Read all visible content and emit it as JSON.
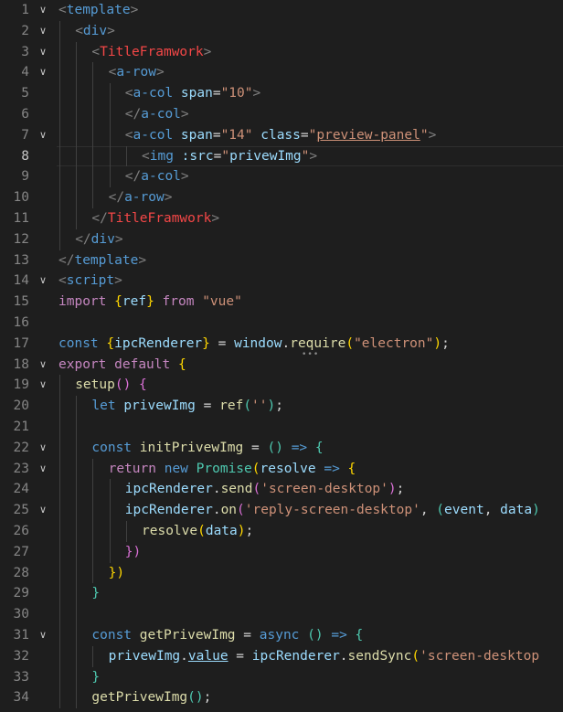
{
  "editor": {
    "current_line": 8,
    "lines": [
      {
        "n": "1",
        "fold": "v",
        "indent": 0,
        "tokens": [
          [
            "t-punc",
            "<"
          ],
          [
            "t-tag",
            "template"
          ],
          [
            "t-punc",
            ">"
          ]
        ]
      },
      {
        "n": "2",
        "fold": "v",
        "indent": 1,
        "tokens": [
          [
            "t-punc",
            "<"
          ],
          [
            "t-tag",
            "div"
          ],
          [
            "t-punc",
            ">"
          ]
        ]
      },
      {
        "n": "3",
        "fold": "v",
        "indent": 2,
        "tokens": [
          [
            "t-punc",
            "<"
          ],
          [
            "t-comp",
            "TitleFramwork"
          ],
          [
            "t-punc",
            ">"
          ]
        ]
      },
      {
        "n": "4",
        "fold": "v",
        "indent": 3,
        "tokens": [
          [
            "t-punc",
            "<"
          ],
          [
            "t-tag",
            "a-row"
          ],
          [
            "t-punc",
            ">"
          ]
        ]
      },
      {
        "n": "5",
        "fold": "",
        "indent": 4,
        "tokens": [
          [
            "t-punc",
            "<"
          ],
          [
            "t-tag",
            "a-col"
          ],
          [
            "t-op",
            " "
          ],
          [
            "t-attr",
            "span"
          ],
          [
            "t-op",
            "="
          ],
          [
            "t-str",
            "\"10\""
          ],
          [
            "t-punc",
            ">"
          ]
        ]
      },
      {
        "n": "6",
        "fold": "",
        "indent": 4,
        "tokens": [
          [
            "t-punc",
            "</"
          ],
          [
            "t-tag",
            "a-col"
          ],
          [
            "t-punc",
            ">"
          ]
        ]
      },
      {
        "n": "7",
        "fold": "v",
        "indent": 4,
        "tokens": [
          [
            "t-punc",
            "<"
          ],
          [
            "t-tag",
            "a-col"
          ],
          [
            "t-op",
            " "
          ],
          [
            "t-attr",
            "span"
          ],
          [
            "t-op",
            "="
          ],
          [
            "t-str",
            "\"14\""
          ],
          [
            "t-op",
            " "
          ],
          [
            "t-attr",
            "class"
          ],
          [
            "t-op",
            "="
          ],
          [
            "t-str",
            "\""
          ],
          [
            "t-str-u",
            "preview-panel"
          ],
          [
            "t-str",
            "\""
          ],
          [
            "t-punc",
            ">"
          ]
        ]
      },
      {
        "n": "8",
        "fold": "",
        "indent": 5,
        "tokens": [
          [
            "t-punc",
            "<"
          ],
          [
            "t-tag",
            "img"
          ],
          [
            "t-op",
            " "
          ],
          [
            "t-attr",
            ":src"
          ],
          [
            "t-op",
            "="
          ],
          [
            "t-str",
            "\""
          ],
          [
            "t-var",
            "privewImg"
          ],
          [
            "t-str",
            "\""
          ],
          [
            "t-punc",
            ">"
          ]
        ]
      },
      {
        "n": "9",
        "fold": "",
        "indent": 4,
        "tokens": [
          [
            "t-punc",
            "</"
          ],
          [
            "t-tag",
            "a-col"
          ],
          [
            "t-punc",
            ">"
          ]
        ]
      },
      {
        "n": "10",
        "fold": "",
        "indent": 3,
        "tokens": [
          [
            "t-punc",
            "</"
          ],
          [
            "t-tag",
            "a-row"
          ],
          [
            "t-punc",
            ">"
          ]
        ]
      },
      {
        "n": "11",
        "fold": "",
        "indent": 2,
        "tokens": [
          [
            "t-punc",
            "</"
          ],
          [
            "t-comp",
            "TitleFramwork"
          ],
          [
            "t-punc",
            ">"
          ]
        ]
      },
      {
        "n": "12",
        "fold": "",
        "indent": 1,
        "tokens": [
          [
            "t-punc",
            "</"
          ],
          [
            "t-tag",
            "div"
          ],
          [
            "t-punc",
            ">"
          ]
        ]
      },
      {
        "n": "13",
        "fold": "",
        "indent": 0,
        "tokens": [
          [
            "t-punc",
            "</"
          ],
          [
            "t-tag",
            "template"
          ],
          [
            "t-punc",
            ">"
          ]
        ]
      },
      {
        "n": "14",
        "fold": "v",
        "indent": 0,
        "tokens": [
          [
            "t-punc",
            "<"
          ],
          [
            "t-tag",
            "script"
          ],
          [
            "t-punc",
            ">"
          ]
        ]
      },
      {
        "n": "15",
        "fold": "",
        "indent": 0,
        "tokens": [
          [
            "t-kw",
            "import"
          ],
          [
            "t-op",
            " "
          ],
          [
            "t-brace",
            "{"
          ],
          [
            "t-var",
            "ref"
          ],
          [
            "t-brace",
            "}"
          ],
          [
            "t-op",
            " "
          ],
          [
            "t-kw",
            "from"
          ],
          [
            "t-op",
            " "
          ],
          [
            "t-str",
            "\"vue\""
          ]
        ]
      },
      {
        "n": "16",
        "fold": "",
        "indent": 0,
        "tokens": []
      },
      {
        "n": "17",
        "fold": "",
        "indent": 0,
        "tokens": [
          [
            "t-decl",
            "const"
          ],
          [
            "t-op",
            " "
          ],
          [
            "t-brace",
            "{"
          ],
          [
            "t-var",
            "ipcRenderer"
          ],
          [
            "t-brace",
            "}"
          ],
          [
            "t-op",
            " = "
          ],
          [
            "t-var",
            "window"
          ],
          [
            "t-op",
            "."
          ],
          [
            "t-fn",
            "require"
          ],
          [
            "t-brace",
            "("
          ],
          [
            "t-str",
            "\"electron\""
          ],
          [
            "t-brace",
            ")"
          ],
          [
            "t-op",
            ";"
          ]
        ]
      },
      {
        "n": "18",
        "fold": "v",
        "indent": 0,
        "tokens": [
          [
            "t-kw",
            "export"
          ],
          [
            "t-op",
            " "
          ],
          [
            "t-kw",
            "default"
          ],
          [
            "t-op",
            " "
          ],
          [
            "t-brace",
            "{"
          ]
        ]
      },
      {
        "n": "19",
        "fold": "v",
        "indent": 1,
        "tokens": [
          [
            "t-fn",
            "setup"
          ],
          [
            "t-brace2",
            "()"
          ],
          [
            "t-op",
            " "
          ],
          [
            "t-brace2",
            "{"
          ]
        ]
      },
      {
        "n": "20",
        "fold": "",
        "indent": 2,
        "tokens": [
          [
            "t-decl",
            "let"
          ],
          [
            "t-op",
            " "
          ],
          [
            "t-var",
            "privewImg"
          ],
          [
            "t-op",
            " = "
          ],
          [
            "t-fn",
            "ref"
          ],
          [
            "t-cls",
            "("
          ],
          [
            "t-str",
            "''"
          ],
          [
            "t-cls",
            ")"
          ],
          [
            "t-op",
            ";"
          ]
        ]
      },
      {
        "n": "21",
        "fold": "",
        "indent": 2,
        "tokens": []
      },
      {
        "n": "22",
        "fold": "v",
        "indent": 2,
        "tokens": [
          [
            "t-decl",
            "const"
          ],
          [
            "t-op",
            " "
          ],
          [
            "t-fn",
            "initPrivewImg"
          ],
          [
            "t-op",
            " = "
          ],
          [
            "t-cls",
            "()"
          ],
          [
            "t-op",
            " "
          ],
          [
            "t-decl",
            "=>"
          ],
          [
            "t-op",
            " "
          ],
          [
            "t-cls",
            "{"
          ]
        ]
      },
      {
        "n": "23",
        "fold": "v",
        "indent": 3,
        "tokens": [
          [
            "t-kw",
            "return"
          ],
          [
            "t-op",
            " "
          ],
          [
            "t-decl",
            "new"
          ],
          [
            "t-op",
            " "
          ],
          [
            "t-cls",
            "Promise"
          ],
          [
            "t-brace",
            "("
          ],
          [
            "t-var",
            "resolve"
          ],
          [
            "t-op",
            " "
          ],
          [
            "t-decl",
            "=>"
          ],
          [
            "t-op",
            " "
          ],
          [
            "t-brace",
            "{"
          ]
        ]
      },
      {
        "n": "24",
        "fold": "",
        "indent": 4,
        "tokens": [
          [
            "t-var",
            "ipcRenderer"
          ],
          [
            "t-op",
            "."
          ],
          [
            "t-fn",
            "send"
          ],
          [
            "t-brace2",
            "("
          ],
          [
            "t-str",
            "'screen-desktop'"
          ],
          [
            "t-brace2",
            ")"
          ],
          [
            "t-op",
            ";"
          ]
        ]
      },
      {
        "n": "25",
        "fold": "v",
        "indent": 4,
        "tokens": [
          [
            "t-var",
            "ipcRenderer"
          ],
          [
            "t-op",
            "."
          ],
          [
            "t-fn",
            "on"
          ],
          [
            "t-brace2",
            "("
          ],
          [
            "t-str",
            "'reply-screen-desktop'"
          ],
          [
            "t-op",
            ", "
          ],
          [
            "t-cls",
            "("
          ],
          [
            "t-var",
            "event"
          ],
          [
            "t-op",
            ", "
          ],
          [
            "t-var",
            "data"
          ],
          [
            "t-cls",
            ")"
          ]
        ]
      },
      {
        "n": "26",
        "fold": "",
        "indent": 5,
        "tokens": [
          [
            "t-fn",
            "resolve"
          ],
          [
            "t-brace",
            "("
          ],
          [
            "t-var",
            "data"
          ],
          [
            "t-brace",
            ")"
          ],
          [
            "t-op",
            ";"
          ]
        ]
      },
      {
        "n": "27",
        "fold": "",
        "indent": 4,
        "tokens": [
          [
            "t-brace2",
            "})"
          ]
        ]
      },
      {
        "n": "28",
        "fold": "",
        "indent": 3,
        "tokens": [
          [
            "t-brace",
            "})"
          ]
        ]
      },
      {
        "n": "29",
        "fold": "",
        "indent": 2,
        "tokens": [
          [
            "t-cls",
            "}"
          ]
        ]
      },
      {
        "n": "30",
        "fold": "",
        "indent": 2,
        "tokens": []
      },
      {
        "n": "31",
        "fold": "v",
        "indent": 2,
        "tokens": [
          [
            "t-decl",
            "const"
          ],
          [
            "t-op",
            " "
          ],
          [
            "t-fn",
            "getPrivewImg"
          ],
          [
            "t-op",
            " = "
          ],
          [
            "t-decl",
            "async"
          ],
          [
            "t-op",
            " "
          ],
          [
            "t-cls",
            "()"
          ],
          [
            "t-op",
            " "
          ],
          [
            "t-decl",
            "=>"
          ],
          [
            "t-op",
            " "
          ],
          [
            "t-cls",
            "{"
          ]
        ]
      },
      {
        "n": "32",
        "fold": "",
        "indent": 3,
        "tokens": [
          [
            "t-var",
            "privewImg"
          ],
          [
            "t-op",
            "."
          ],
          [
            "t-var-u",
            "value"
          ],
          [
            "t-op",
            " = "
          ],
          [
            "t-var",
            "ipcRenderer"
          ],
          [
            "t-op",
            "."
          ],
          [
            "t-fn",
            "sendSync"
          ],
          [
            "t-brace",
            "("
          ],
          [
            "t-str",
            "'screen-desktop"
          ]
        ]
      },
      {
        "n": "33",
        "fold": "",
        "indent": 2,
        "tokens": [
          [
            "t-cls",
            "}"
          ]
        ]
      },
      {
        "n": "34",
        "fold": "",
        "indent": 2,
        "tokens": [
          [
            "t-fn",
            "getPrivewImg"
          ],
          [
            "t-cls",
            "()"
          ],
          [
            "t-op",
            ";"
          ]
        ]
      }
    ]
  }
}
